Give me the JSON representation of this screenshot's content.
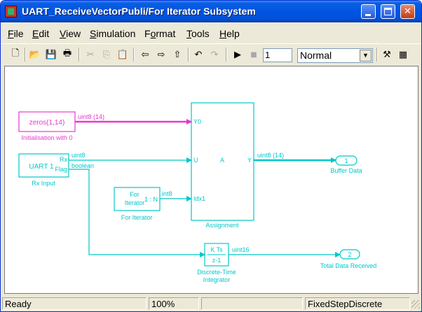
{
  "window": {
    "title": "UART_ReceiveVectorPubli/For Iterator Subsystem"
  },
  "menu": [
    "File",
    "Edit",
    "View",
    "Simulation",
    "Format",
    "Tools",
    "Help"
  ],
  "menu_mnemonics": [
    "F",
    "E",
    "V",
    "S",
    "o",
    "T",
    "H"
  ],
  "toolbar": {
    "stop_time": "1",
    "sim_mode": "Normal"
  },
  "status": {
    "state": "Ready",
    "zoom": "100%",
    "solver": "FixedStepDiscrete"
  },
  "colors": {
    "signal": "#00c8c8",
    "highlight": "#e838d0",
    "title_bar": "#0054e3",
    "chrome": "#ece9d8"
  },
  "blocks": {
    "zeros": {
      "text": "zeros(1,14)",
      "label": "Initialisation with 0"
    },
    "rx": {
      "line1": "UART 1",
      "port_rx": "Rx",
      "port_flag": "Flag",
      "label": "Rx Input"
    },
    "for_iter": {
      "line1": "For",
      "line2": "Iterator",
      "range": "1 : N",
      "label": "For Iterator"
    },
    "assign": {
      "port_y0": "Y0",
      "port_u": "U",
      "port_a": "A",
      "port_y": "Y",
      "port_idx": "Idx1",
      "label": "Assignment"
    },
    "integ": {
      "num": "K Ts",
      "den": "z-1",
      "label1": "Discrete-Time",
      "label2": "Integrator"
    },
    "out1": {
      "num": "1",
      "label": "Buffer Data"
    },
    "out2": {
      "num": "2",
      "label": "Total Data Received"
    }
  },
  "signals": {
    "zeros_out": "uint8 (14)",
    "rx_out": "uint8",
    "flag_out": "boolean",
    "iter_out": "int8",
    "assign_out": "uint8 (14)",
    "integ_out": "uint16"
  }
}
